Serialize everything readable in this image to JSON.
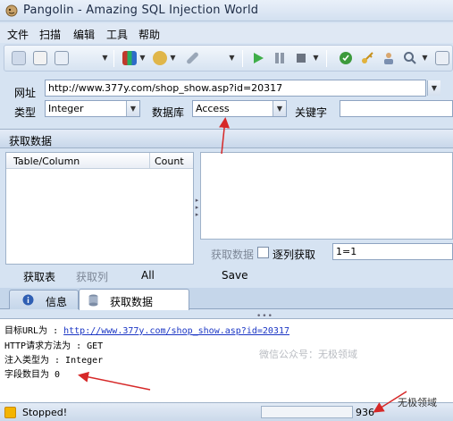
{
  "window": {
    "title": "Pangolin - Amazing SQL Injection World"
  },
  "menu": [
    "文件",
    "扫描",
    "编辑",
    "工具",
    "帮助"
  ],
  "toolbar": {
    "icons": [
      "magnifier-icon",
      "open-file-icon",
      "document-icon",
      "dropdown-icon",
      "books-icon",
      "dropdown-icon",
      "settings-icon",
      "dropdown-icon",
      "wrench-icon",
      "dropdown-icon",
      "play-icon",
      "pause-icon",
      "stop-icon",
      "dropdown-icon",
      "globe-icon",
      "key-icon",
      "user-icon",
      "search-icon",
      "dropdown-icon"
    ]
  },
  "url": {
    "label": "网址",
    "value": "http://www.377y.com/shop_show.asp?id=20317"
  },
  "type": {
    "label": "类型",
    "value": "Integer"
  },
  "database": {
    "label": "数据库",
    "value": "Access"
  },
  "keyword": {
    "label": "关键字",
    "value": ""
  },
  "section": {
    "title": "获取数据"
  },
  "table": {
    "columns": [
      "Table/Column",
      "Count"
    ]
  },
  "left_buttons": {
    "get_tables": "获取表",
    "get_columns": "获取列",
    "all": "All"
  },
  "right_controls": {
    "get_data": "获取数据",
    "row_by_row": "逐列获取",
    "condition": "1=1",
    "save": "Save"
  },
  "tabs": [
    {
      "label": "信息",
      "icon": "info-icon"
    },
    {
      "label": "获取数据",
      "icon": "database-icon"
    }
  ],
  "log": {
    "target_label": "目标URL为 : ",
    "target_url": "http://www.377y.com/shop_show.asp?id=20317",
    "method": "HTTP请求方法为 : GET",
    "inject_type": "注入类型为 : Integer",
    "field_count": "字段数目为 0"
  },
  "watermark": "微信公众号：无极领域",
  "status": {
    "text": "Stopped!",
    "count": "936",
    "watermark": "无极领域"
  },
  "colors": {
    "accent": "#1a35c4",
    "arrow": "#d62828"
  }
}
